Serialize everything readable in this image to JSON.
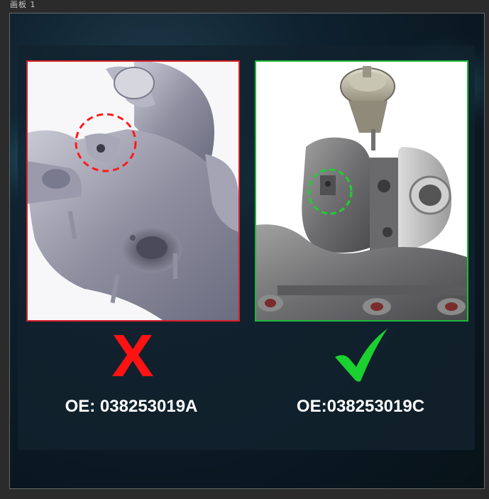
{
  "app": {
    "tab_title": "画板 1"
  },
  "comparison": {
    "wrong": {
      "oe_label": "OE: 038253019A",
      "mark_icon": "red-x-icon",
      "frame_color": "#d4202c"
    },
    "correct": {
      "oe_label": "OE:038253019C",
      "mark_icon": "green-check-icon",
      "frame_color": "#1fb83a"
    }
  },
  "colors": {
    "background": "#0a1822",
    "wrong": "#ff1a1a",
    "correct": "#1bd12f"
  }
}
